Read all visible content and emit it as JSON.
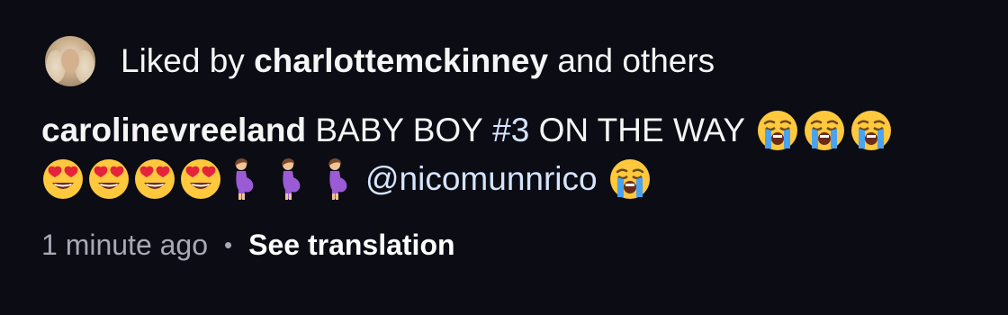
{
  "likes": {
    "prefix": "Liked by",
    "user": "charlottemckinney",
    "suffix": "and others"
  },
  "comment": {
    "username": "carolinevreeland",
    "text_main": "BABY BOY",
    "hashtag": "#3",
    "text_after_hashtag": "ON THE WAY",
    "mention": "@nicomunnrico",
    "emojis_line1": [
      "crying-face-emoji",
      "crying-face-emoji",
      "crying-face-emoji"
    ],
    "emojis_line2": [
      "heart-eyes-emoji",
      "heart-eyes-emoji",
      "heart-eyes-emoji",
      "heart-eyes-emoji",
      "pregnant-woman-emoji",
      "pregnant-woman-emoji",
      "pregnant-woman-emoji"
    ],
    "emoji_after_mention": "crying-face-emoji"
  },
  "meta": {
    "timestamp": "1 minute ago",
    "separator": "•",
    "see_translation": "See translation"
  },
  "colors": {
    "background": "#0b0c14",
    "text": "#f5f5f5",
    "link": "#d6e4ff",
    "muted": "#a7a9b4"
  }
}
